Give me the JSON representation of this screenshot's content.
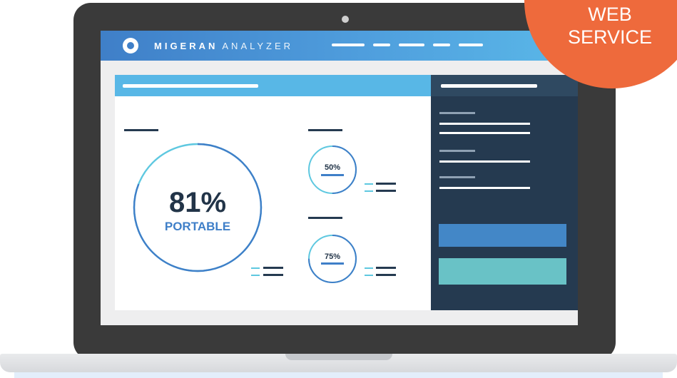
{
  "app": {
    "brand_bold": "MIGERAN",
    "brand_light": "ANALYZER",
    "nav_item_count": 5
  },
  "main_gauge": {
    "value_label": "81%",
    "caption": "PORTABLE",
    "fraction": 0.81
  },
  "small_gauges": [
    {
      "value_label": "50%",
      "fraction": 0.5
    },
    {
      "value_label": "75%",
      "fraction": 0.75
    }
  ],
  "badge": {
    "line1": "WEB",
    "line2": "SERVICE"
  },
  "colors": {
    "header_gradient_start": "#3f7fc8",
    "header_gradient_end": "#5ab8e8",
    "panel_title": "#58b7e6",
    "side_panel": "#253a50",
    "gauge_blue": "#3f7fc8",
    "gauge_teal": "#5ec8e0",
    "button_blue": "#4387c7",
    "button_teal": "#69c2c6",
    "badge_orange": "#ee6a3c",
    "text_dark": "#223448"
  },
  "icons": [
    "logo-icon",
    "camera-icon"
  ]
}
